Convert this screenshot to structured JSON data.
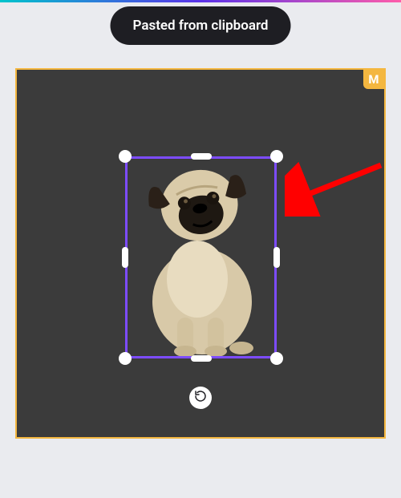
{
  "toast": {
    "message": "Pasted from clipboard"
  },
  "canvas": {
    "badge_label": "M",
    "border_color": "#F4B740",
    "background": "#3B3B3B"
  },
  "selection": {
    "border_color": "#7D4CFF",
    "image_description": "Pug dog sitting, cut-out with transparent background"
  },
  "controls": {
    "rotate_label": "Rotate"
  },
  "annotation": {
    "arrow_color": "#FF0000",
    "arrow_target": "selection right edge"
  }
}
